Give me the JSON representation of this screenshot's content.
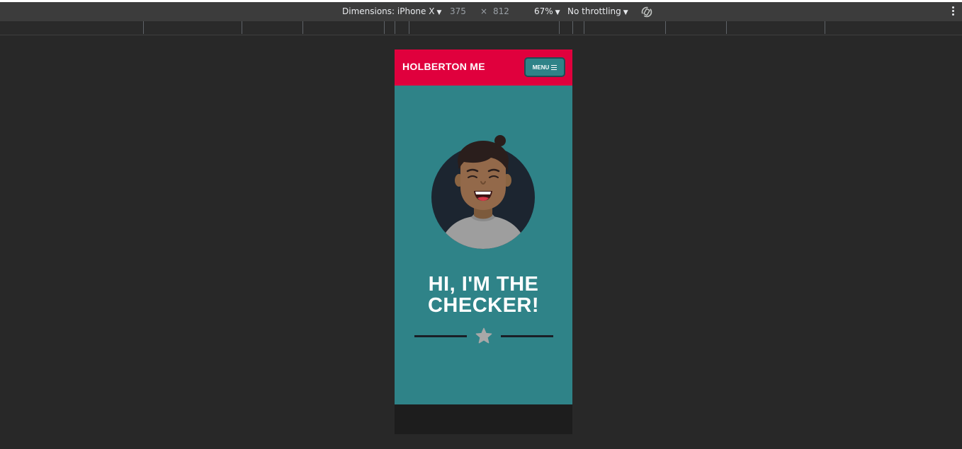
{
  "devtools": {
    "dimensions_label": "Dimensions: iPhone X",
    "width": "375",
    "times": "×",
    "height": "812",
    "zoom": "67%",
    "throttling": "No throttling",
    "caret_icon": "triangle-down-icon",
    "rotate_icon": "rotate-icon",
    "more_icon": "kebab-menu-icon"
  },
  "page": {
    "brand": "HOLBERTON ME",
    "menu_label": "MENU",
    "menu_icon": "hamburger-icon",
    "hero_title_line1": "HI, I'M THE",
    "hero_title_line2": "CHECKER!",
    "divider_icon": "star-icon",
    "avatar_icon": "avatar-illustration"
  },
  "colors": {
    "header_bg": "#e0003d",
    "hero_bg": "#2f8388",
    "menu_border": "#1d4d55",
    "avatar_circle": "#1c2530",
    "shirt": "#9e9e9e",
    "star": "#a8a8a8",
    "divider_line": "#1a1f26"
  }
}
